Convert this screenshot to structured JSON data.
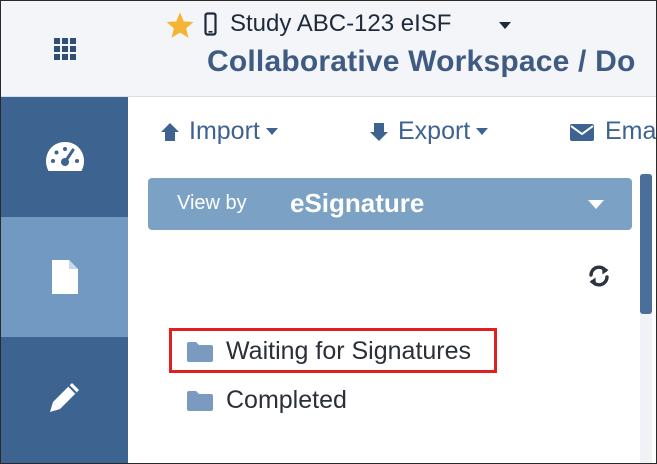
{
  "header": {
    "study_label": "Study ABC-123 eISF",
    "workspace_title": "Collaborative Workspace / Do"
  },
  "sidebar": {
    "items": [
      {
        "icon": "dashboard-icon",
        "active": false
      },
      {
        "icon": "document-icon",
        "active": true
      },
      {
        "icon": "pencil-icon",
        "active": false
      }
    ]
  },
  "toolbar": {
    "import_label": "Import",
    "export_label": "Export",
    "email_label": "Ema"
  },
  "view_by": {
    "prefix": "View by",
    "value": "eSignature"
  },
  "tree": {
    "items": [
      {
        "label": "Waiting for Signatures",
        "highlighted": true
      },
      {
        "label": "Completed",
        "highlighted": false
      }
    ]
  },
  "colors": {
    "sidebar": "#3d6391",
    "sidebar_active": "#7199c1",
    "accent": "#3f6390",
    "dropdown": "#7ba1c4",
    "highlight": "#e02020"
  }
}
